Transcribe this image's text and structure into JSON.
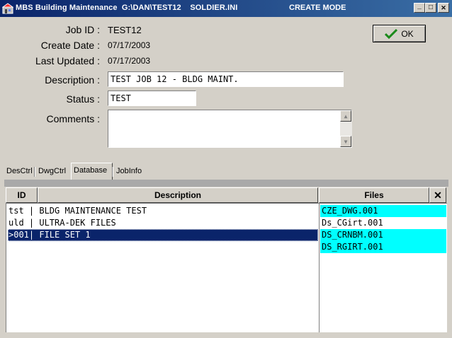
{
  "titlebar": {
    "title": "MBS Building Maintenance  G:\\DAN\\TEST12    SOLDIER.INI",
    "mode": "CREATE MODE",
    "minimize": "_",
    "maximize": "□",
    "close": "✕"
  },
  "form": {
    "job_id_label": "Job ID :",
    "job_id_value": "TEST12",
    "create_date_label": "Create Date :",
    "create_date_value": "07/17/2003",
    "last_updated_label": "Last Updated :",
    "last_updated_value": "07/17/2003",
    "description_label": "Description :",
    "description_value": "TEST JOB 12 - BLDG MAINT.",
    "status_label": "Status :",
    "status_value": "TEST",
    "comments_label": "Comments :",
    "comments_value": ""
  },
  "ok_button": {
    "label": "OK",
    "icon": "checkmark-icon",
    "icon_color": "#1a8a1a"
  },
  "tabs": [
    {
      "label": "DesCtrl",
      "active": false
    },
    {
      "label": "DwgCtrl",
      "active": false
    },
    {
      "label": "Database",
      "active": true
    },
    {
      "label": "JobInfo",
      "active": false
    }
  ],
  "grid": {
    "col_id": "ID",
    "col_description": "Description",
    "rows": [
      {
        "text": "tst | BLDG MAINTENANCE TEST",
        "selected": false
      },
      {
        "text": "uld | ULTRA-DEK FILES",
        "selected": false
      },
      {
        "text": ">001| FILE SET 1",
        "selected": true
      }
    ]
  },
  "files": {
    "header": "Files",
    "close_label": "✕",
    "items": [
      {
        "name": "CZE_DWG.001",
        "highlight": true
      },
      {
        "name": "Ds_CGirt.001",
        "highlight": false
      },
      {
        "name": "DS_CRNBM.001",
        "highlight": true
      },
      {
        "name": "DS_RGIRT.001",
        "highlight": true
      }
    ],
    "highlight_color": "#00ffff"
  },
  "colors": {
    "title_start": "#0a246a",
    "title_end": "#3a6ea5",
    "face": "#d4d0c8",
    "selection": "#0a246a"
  }
}
